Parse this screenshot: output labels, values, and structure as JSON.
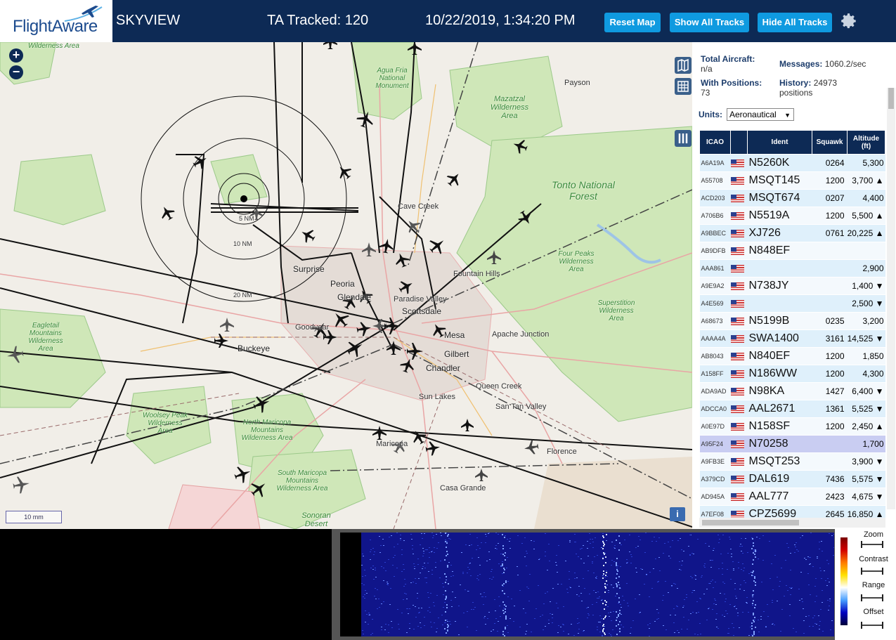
{
  "header": {
    "logo_text": "FlightAware",
    "app_name": "SKYVIEW",
    "tracked": "TA Tracked: 120",
    "datetime": "10/22/2019, 1:34:20 PM",
    "buttons": {
      "reset": "Reset Map",
      "show": "Show All Tracks",
      "hide": "Hide All Tracks"
    },
    "settings_icon": "gear-icon"
  },
  "map": {
    "labels": {
      "surprise": "Surprise",
      "peoria": "Peoria",
      "glendale": "Glendale",
      "scottsdale": "Scottsdale",
      "paradise_valley": "Paradise Valley",
      "mesa": "Mesa",
      "gilbert": "Gilbert",
      "chandler": "Chandler",
      "buckeye": "Buckeye",
      "fountain_hills": "Fountain Hills",
      "apache_junction": "Apache Junction",
      "queen_creek": "Queen Creek",
      "san_tan_valley": "San Tan Valley",
      "florence": "Florence",
      "casa_grande": "Casa Grande",
      "maricopa": "Maricopa",
      "payson": "Payson",
      "cave_creek": "Cave Creek",
      "surprise2": "Sun Lakes",
      "goodyear": "Goodyear"
    },
    "green_labels": {
      "agua_fria": "Agua Fria National Monument",
      "mazatzal": "Mazatzal Wilderness Area",
      "tonto": "Tonto National Forest",
      "four_peaks": "Four Peaks Wilderness Area",
      "superstition": "Superstition Wilderness Area",
      "eagletail": "Eagletail Mountains Wilderness Area",
      "woolsey": "Woolsey Peak Wilderness Area",
      "north_maricopa": "North Maricopa Mountains Wilderness Area",
      "south_maricopa": "South Maricopa Mountains Wilderness Area",
      "sonoran": "Sonoran Desert",
      "top_wild": "Wilderness Area"
    },
    "range_rings": [
      "5 NM",
      "10 NM",
      "20 NM"
    ],
    "scale": "10 mm",
    "zoom_in": "+",
    "zoom_out": "−",
    "info": "i"
  },
  "panel": {
    "total_aircraft_label": "Total Aircraft:",
    "total_aircraft_value": "n/a",
    "messages_label": "Messages:",
    "messages_value": "1060.2/sec",
    "with_positions_label": "With Positions:",
    "with_positions_value": "73",
    "history_label": "History:",
    "history_value": "24973 positions",
    "units_label": "Units:",
    "units_value": "Aeronautical",
    "columns": [
      "ICAO",
      "",
      "Ident",
      "Squawk",
      "Altitude (ft)"
    ],
    "rows": [
      {
        "icao": "A6A19A",
        "ident": "N5260K",
        "squawk": "0264",
        "alt": "5,300"
      },
      {
        "icao": "A55708",
        "ident": "MSQT145",
        "squawk": "1200",
        "alt": "3,700 ▲"
      },
      {
        "icao": "ACD203",
        "ident": "MSQT674",
        "squawk": "0207",
        "alt": "4,400"
      },
      {
        "icao": "A706B6",
        "ident": "N5519A",
        "squawk": "1200",
        "alt": "5,500 ▲"
      },
      {
        "icao": "A9BBEC",
        "ident": "XJ726",
        "squawk": "0761",
        "alt": "20,225 ▲"
      },
      {
        "icao": "AB9DFB",
        "ident": "N848EF",
        "squawk": "",
        "alt": ""
      },
      {
        "icao": "AAA861",
        "ident": "",
        "squawk": "",
        "alt": "2,900"
      },
      {
        "icao": "A9E9A2",
        "ident": "N738JY",
        "squawk": "",
        "alt": "1,400 ▼"
      },
      {
        "icao": "A4E569",
        "ident": "",
        "squawk": "",
        "alt": "2,500 ▼"
      },
      {
        "icao": "A68673",
        "ident": "N5199B",
        "squawk": "0235",
        "alt": "3,200"
      },
      {
        "icao": "AAAA4A",
        "ident": "SWA1400",
        "squawk": "3161",
        "alt": "14,525 ▼"
      },
      {
        "icao": "AB8043",
        "ident": "N840EF",
        "squawk": "1200",
        "alt": "1,850"
      },
      {
        "icao": "A158FF",
        "ident": "N186WW",
        "squawk": "1200",
        "alt": "4,300"
      },
      {
        "icao": "ADA9AD",
        "ident": "N98KA",
        "squawk": "1427",
        "alt": "6,400 ▼"
      },
      {
        "icao": "ADCCA0",
        "ident": "AAL2671",
        "squawk": "1361",
        "alt": "5,525 ▼"
      },
      {
        "icao": "A0E97D",
        "ident": "N158SF",
        "squawk": "1200",
        "alt": "2,450 ▲"
      },
      {
        "icao": "A95F24",
        "ident": "N70258",
        "squawk": "",
        "alt": "1,700"
      },
      {
        "icao": "A9FB3E",
        "ident": "MSQT253",
        "squawk": "",
        "alt": "3,900 ▼"
      },
      {
        "icao": "A379CD",
        "ident": "DAL619",
        "squawk": "7436",
        "alt": "5,575 ▼"
      },
      {
        "icao": "AD945A",
        "ident": "AAL777",
        "squawk": "2423",
        "alt": "4,675 ▼"
      },
      {
        "icao": "A7EF08",
        "ident": "CPZ5699",
        "squawk": "2645",
        "alt": "16,850 ▲"
      }
    ],
    "selected_row": 16
  },
  "waterfall": {
    "controls": {
      "zoom": "Zoom",
      "contrast": "Contrast",
      "range": "Range",
      "offset": "Offset"
    }
  },
  "colors": {
    "header_bg": "#0d2a55",
    "button_bg": "#0f9ae0",
    "table_header": "#0d2a55"
  }
}
